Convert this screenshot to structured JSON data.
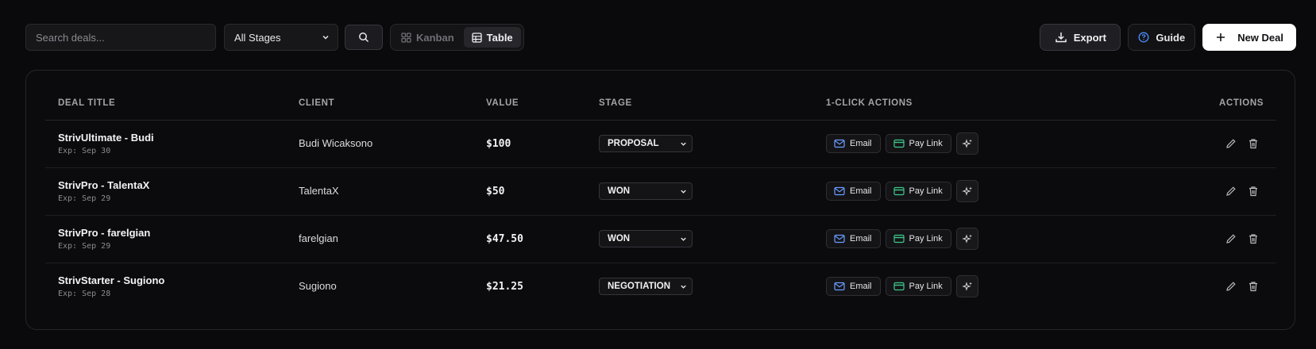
{
  "toolbar": {
    "search_placeholder": "Search deals...",
    "stage_filter": "All Stages",
    "view_kanban": "Kanban",
    "view_table": "Table",
    "export": "Export",
    "guide": "Guide",
    "new_deal": "New Deal"
  },
  "table": {
    "headers": {
      "title": "DEAL TITLE",
      "client": "CLIENT",
      "value": "VALUE",
      "stage": "STAGE",
      "quick": "1-CLICK ACTIONS",
      "actions": "ACTIONS"
    },
    "rows": [
      {
        "title": "StrivUltimate - Budi",
        "exp": "Exp: Sep 30",
        "client": "Budi Wicaksono",
        "value": "$100",
        "stage": "PROPOSAL",
        "email": "Email",
        "paylink": "Pay Link"
      },
      {
        "title": "StrivPro - TalentaX",
        "exp": "Exp: Sep 29",
        "client": "TalentaX",
        "value": "$50",
        "stage": "WON",
        "email": "Email",
        "paylink": "Pay Link"
      },
      {
        "title": "StrivPro - farelgian",
        "exp": "Exp: Sep 29",
        "client": "farelgian",
        "value": "$47.50",
        "stage": "WON",
        "email": "Email",
        "paylink": "Pay Link"
      },
      {
        "title": "StrivStarter - Sugiono",
        "exp": "Exp: Sep 28",
        "client": "Sugiono",
        "value": "$21.25",
        "stage": "NEGOTIATION",
        "email": "Email",
        "paylink": "Pay Link"
      }
    ]
  },
  "colors": {
    "email_icon": "#6b9cff",
    "paylink_icon": "#3ec98a",
    "guide_icon": "#4d8dff"
  }
}
